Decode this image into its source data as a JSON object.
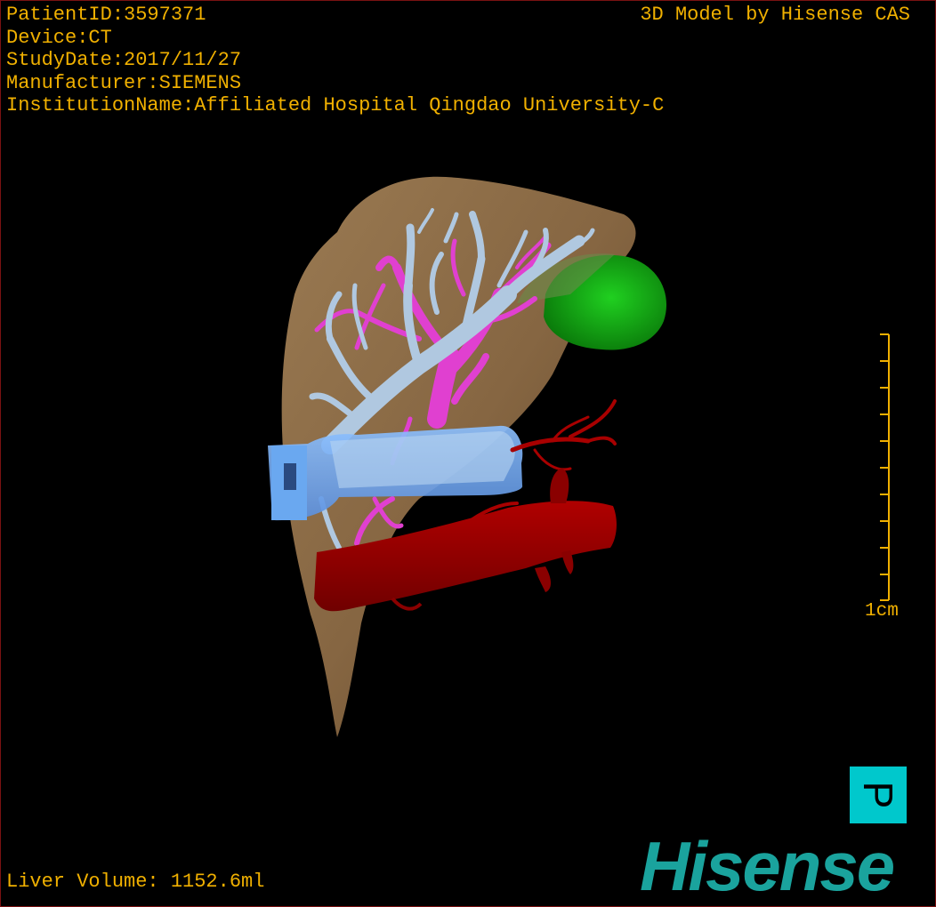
{
  "patient_info": {
    "patient_id": "PatientID:3597371",
    "device": "Device:CT",
    "study_date": "StudyDate:2017/11/27",
    "manufacturer": "Manufacturer:SIEMENS",
    "institution": "InstitutionName:Affiliated Hospital Qingdao University-C"
  },
  "header": {
    "brand_text": "3D Model by Hisense CAS"
  },
  "footer": {
    "liver_volume": "Liver Volume: 1152.6ml"
  },
  "scale": {
    "label": "1cm"
  },
  "orientation": {
    "label": "P"
  },
  "logo": {
    "text": "Hisense"
  },
  "colors": {
    "overlay_text": "#f0b000",
    "liver": "#8a6a45",
    "portal_vein": "#b0c8e0",
    "hepatic_vein": "#e040d0",
    "vena_cava": "#6aa8f0",
    "aorta": "#9a0000",
    "gallbladder": "#10b010",
    "orientation_cube": "#00c8cc",
    "logo": "#1aa39d"
  }
}
